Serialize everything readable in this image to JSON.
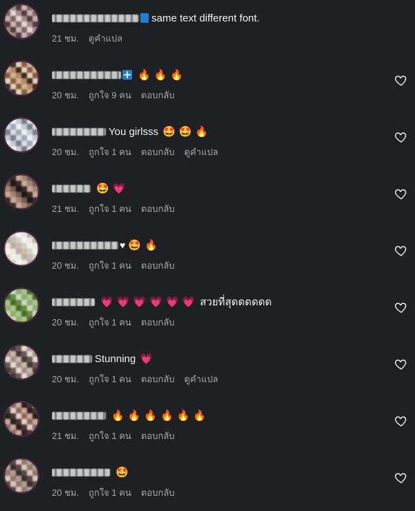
{
  "labels": {
    "see_translation": "ดูคำแปล",
    "reply": "ตอบกลับ"
  },
  "comments": [
    {
      "text": "same text different font.",
      "badge": "blue",
      "emojis": "",
      "time": "21 ชม.",
      "likes": "",
      "avatar_colors": [
        "#e6d6d0",
        "#cbb3aa",
        "#a68a83",
        "#7c6666",
        "#503a46"
      ]
    },
    {
      "text": "",
      "badge": "cross",
      "emojis": "🔥🔥🔥",
      "time": "20 ชม.",
      "likes": "ถูกใจ 9 คน",
      "avatar_colors": [
        "#e3d0c1",
        "#b88a5c",
        "#8a5f3a",
        "#3c2a24",
        "#cbb29a"
      ]
    },
    {
      "text": "You girlsss",
      "badge": "",
      "emojis": "🤩🤩🔥",
      "time": "20 ชม.",
      "likes": "ถูกใจ 1 คน",
      "avatar_colors": [
        "#d8dde2",
        "#c2cbd6",
        "#9ea8b5",
        "#7a7f88",
        "#eef0f2"
      ]
    },
    {
      "text": "",
      "badge": "",
      "emojis": "🤩💗",
      "time": "21 ชม.",
      "likes": "ถูกใจ 1 คน",
      "avatar_colors": [
        "#3a2a2a",
        "#7a5a4c",
        "#c9aa92",
        "#1c1616",
        "#a3857a"
      ]
    },
    {
      "text": "",
      "badge": "heart",
      "emojis": "🤩🔥",
      "time": "20 ชม.",
      "likes": "ถูกใจ 1 คน",
      "avatar_colors": [
        "#ece8e1",
        "#d8cfc6",
        "#b9ada2",
        "#f5f3ef",
        "#c8bdb3"
      ]
    },
    {
      "text": "สวยที่สุดดดดดด",
      "badge": "",
      "emojis": "💗💗💗💗💗💗",
      "time": "20 ชม.",
      "likes": "ถูกใจ 1 คน",
      "avatar_colors": [
        "#6a8c3e",
        "#a9c48a",
        "#c9d8c8",
        "#476b2c",
        "#8fae6b"
      ]
    },
    {
      "text": "Stunning",
      "badge": "",
      "emojis": "💗",
      "time": "20 ชม.",
      "likes": "ถูกใจ 1 คน",
      "avatar_colors": [
        "#6a5a5a",
        "#c9b5aa",
        "#e6d9d0",
        "#453838",
        "#a28d86"
      ]
    },
    {
      "text": "",
      "badge": "",
      "emojis": "🔥🔥🔥🔥🔥🔥",
      "time": "21 ชม.",
      "likes": "ถูกใจ 1 คน",
      "avatar_colors": [
        "#4a3434",
        "#c8a79a",
        "#e4d0c6",
        "#2c2020",
        "#8a6a60"
      ]
    },
    {
      "text": "",
      "badge": "",
      "emojis": "🤩",
      "time": "20 ชม.",
      "likes": "ถูกใจ 1 คน",
      "avatar_colors": [
        "#5a4a48",
        "#b39c92",
        "#d8c6bc",
        "#3a2e2c",
        "#8e786f"
      ]
    }
  ]
}
